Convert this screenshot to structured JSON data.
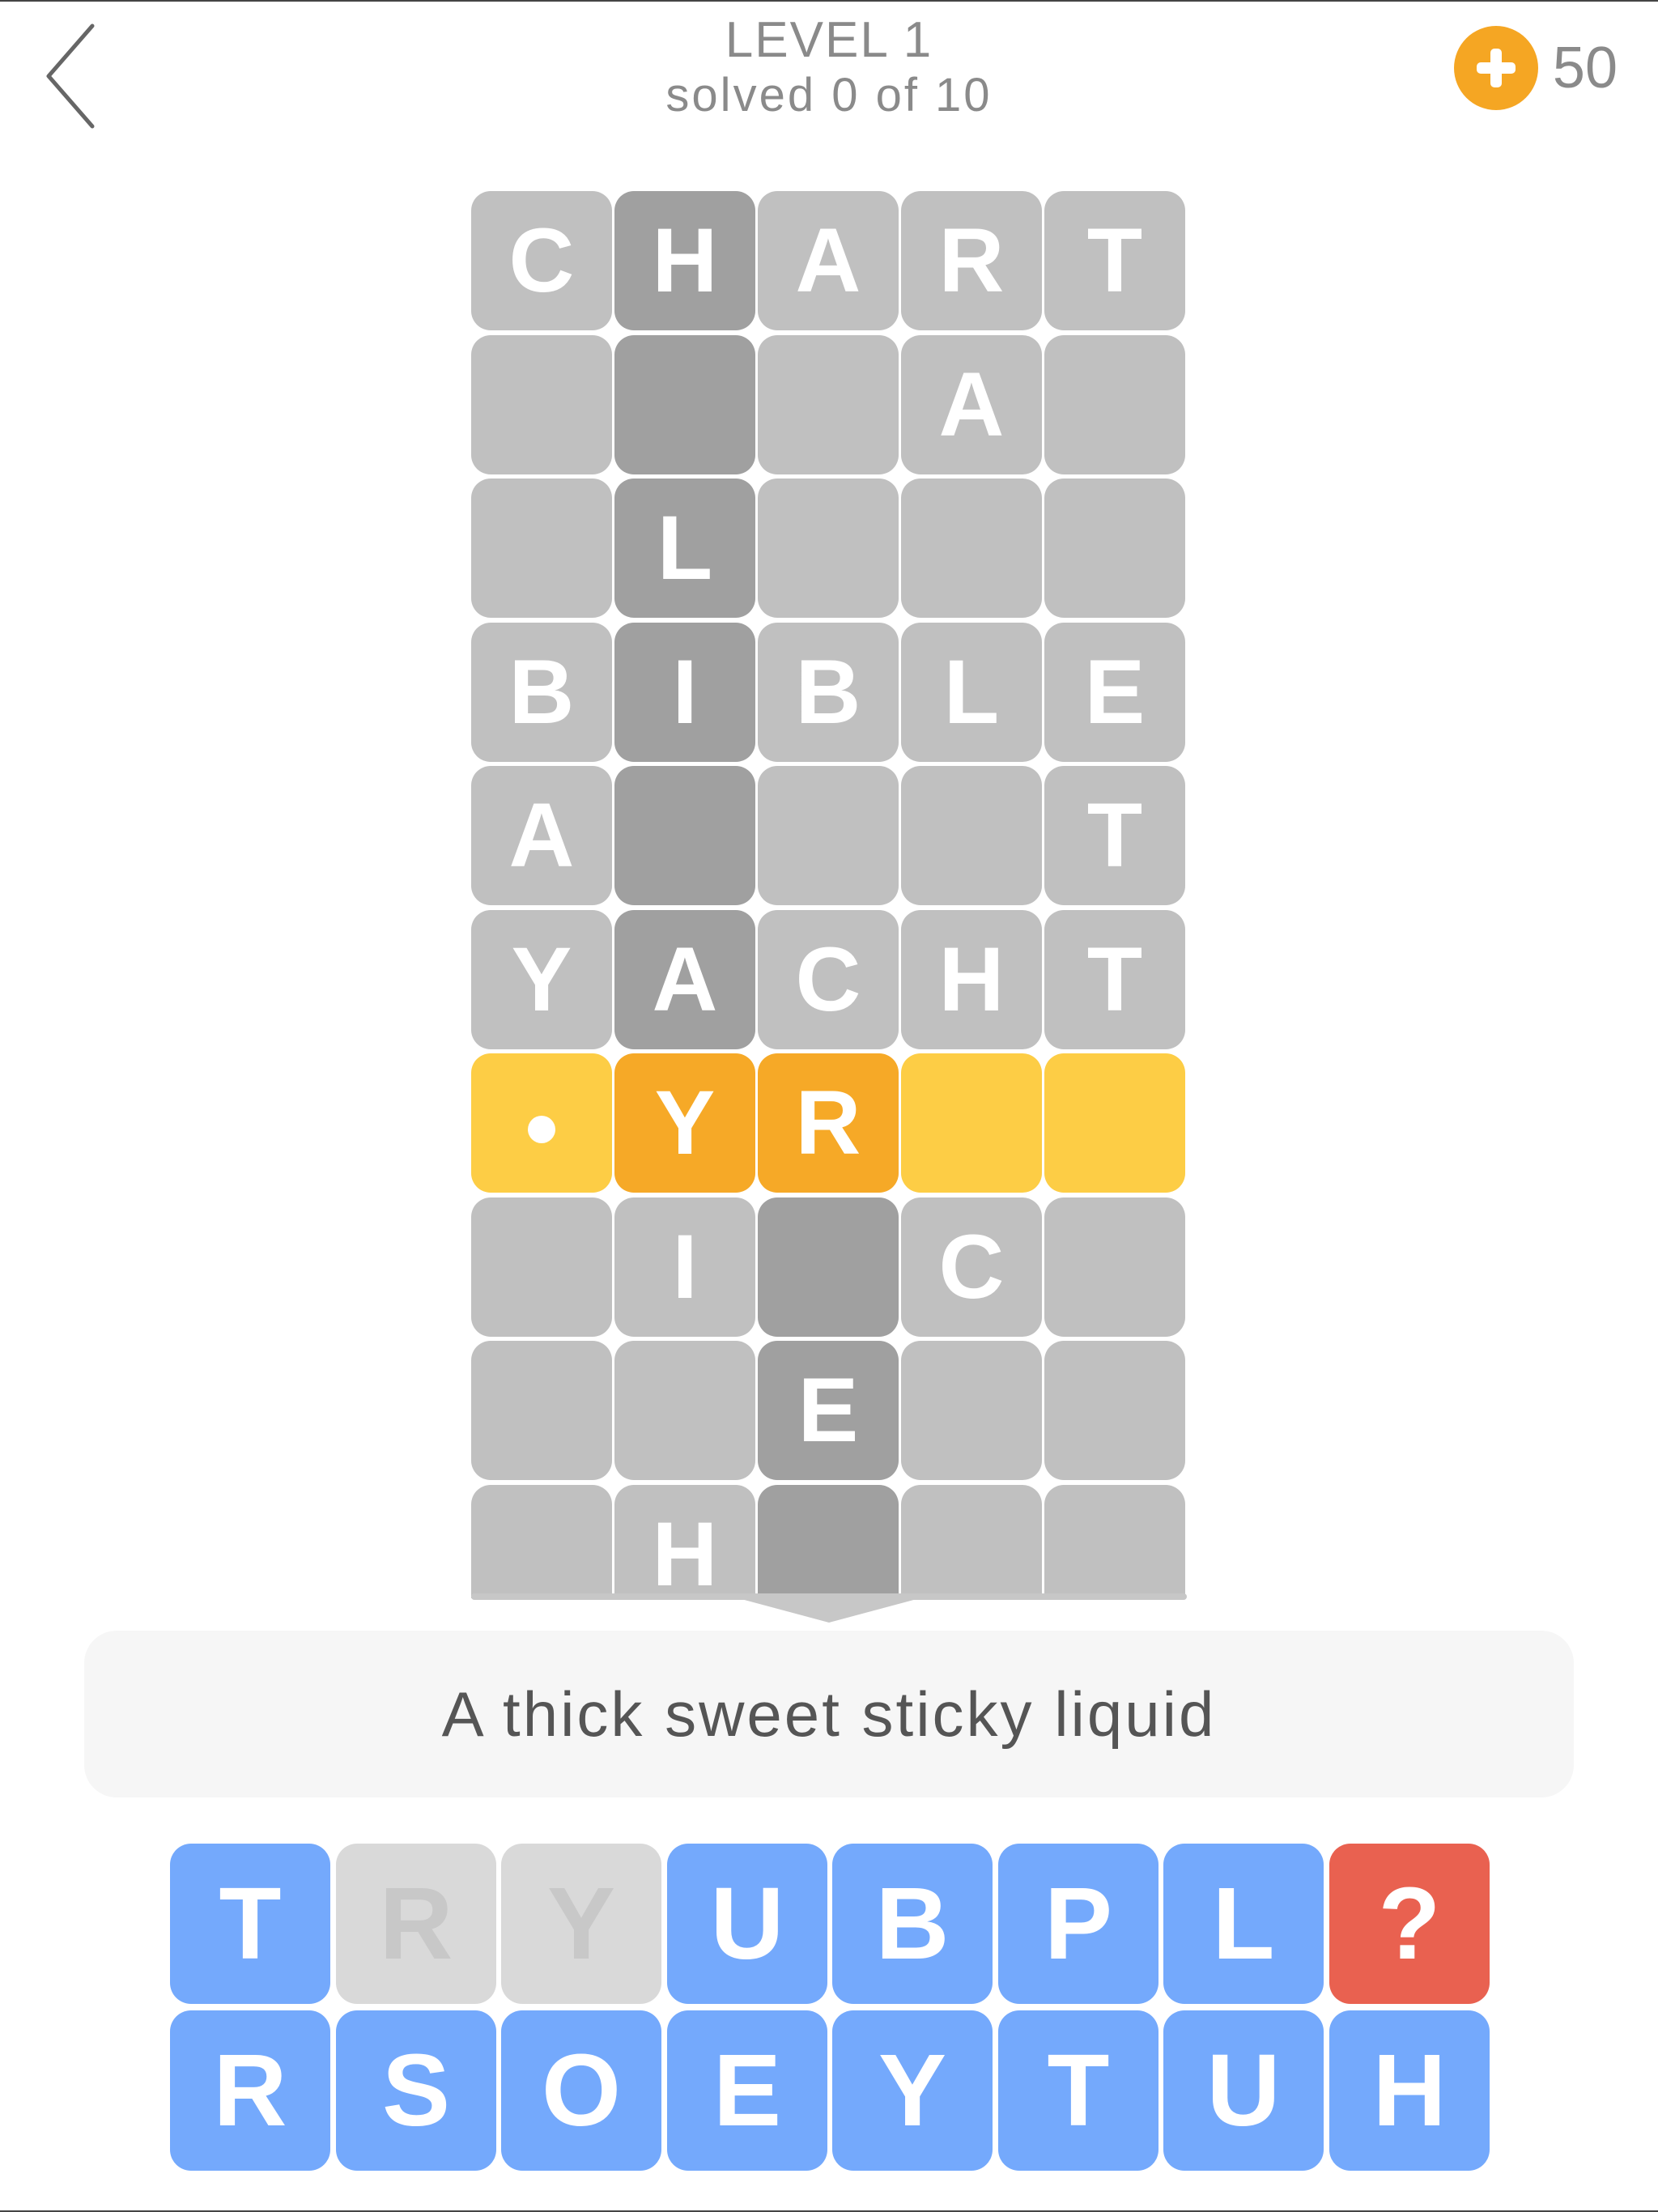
{
  "header": {
    "level_title": "LEVEL 1",
    "progress_text": "solved 0 of 10",
    "coins": "50"
  },
  "colors": {
    "tile_light": "#c0c0c0",
    "tile_dark": "#a0a0a0",
    "active_row": "#fdcd45",
    "active_cell": "#f6a927",
    "key": "#74a9fc",
    "key_used": "#d9d9d9",
    "key_hint": "#e96150",
    "coin": "#f5a623"
  },
  "icons": {
    "back": "chevron-left-icon",
    "coin": "coin-plus-icon",
    "dot": "cursor-dot-icon"
  },
  "grid": {
    "rows": [
      [
        "C",
        "H",
        "A",
        "R",
        "T"
      ],
      [
        "",
        "",
        "",
        "A",
        ""
      ],
      [
        "",
        "L",
        "",
        "",
        ""
      ],
      [
        "B",
        "I",
        "B",
        "L",
        "E"
      ],
      [
        "A",
        "",
        "",
        "",
        "T"
      ],
      [
        "Y",
        "A",
        "C",
        "H",
        "T"
      ],
      [
        "•",
        "Y",
        "R",
        "",
        ""
      ],
      [
        "",
        "I",
        "",
        "C",
        ""
      ],
      [
        "",
        "",
        "E",
        "",
        ""
      ],
      [
        "",
        "H",
        "",
        "",
        ""
      ]
    ],
    "dark_cells": [
      [
        0,
        1
      ],
      [
        1,
        1
      ],
      [
        2,
        1
      ],
      [
        3,
        1
      ],
      [
        4,
        1
      ],
      [
        5,
        1
      ],
      [
        7,
        2
      ],
      [
        8,
        2
      ],
      [
        9,
        2
      ]
    ],
    "active_row": 6,
    "active_cells": [
      1,
      2
    ]
  },
  "clue": {
    "text": "A thick sweet sticky liquid"
  },
  "keyboard": {
    "rows": [
      [
        {
          "letter": "T",
          "state": "available"
        },
        {
          "letter": "R",
          "state": "used"
        },
        {
          "letter": "Y",
          "state": "used"
        },
        {
          "letter": "U",
          "state": "available"
        },
        {
          "letter": "B",
          "state": "available"
        },
        {
          "letter": "P",
          "state": "available"
        },
        {
          "letter": "L",
          "state": "available"
        },
        {
          "letter": "?",
          "state": "hint"
        }
      ],
      [
        {
          "letter": "R",
          "state": "available"
        },
        {
          "letter": "S",
          "state": "available"
        },
        {
          "letter": "O",
          "state": "available"
        },
        {
          "letter": "E",
          "state": "available"
        },
        {
          "letter": "Y",
          "state": "available"
        },
        {
          "letter": "T",
          "state": "available"
        },
        {
          "letter": "U",
          "state": "available"
        },
        {
          "letter": "H",
          "state": "available"
        }
      ]
    ]
  }
}
